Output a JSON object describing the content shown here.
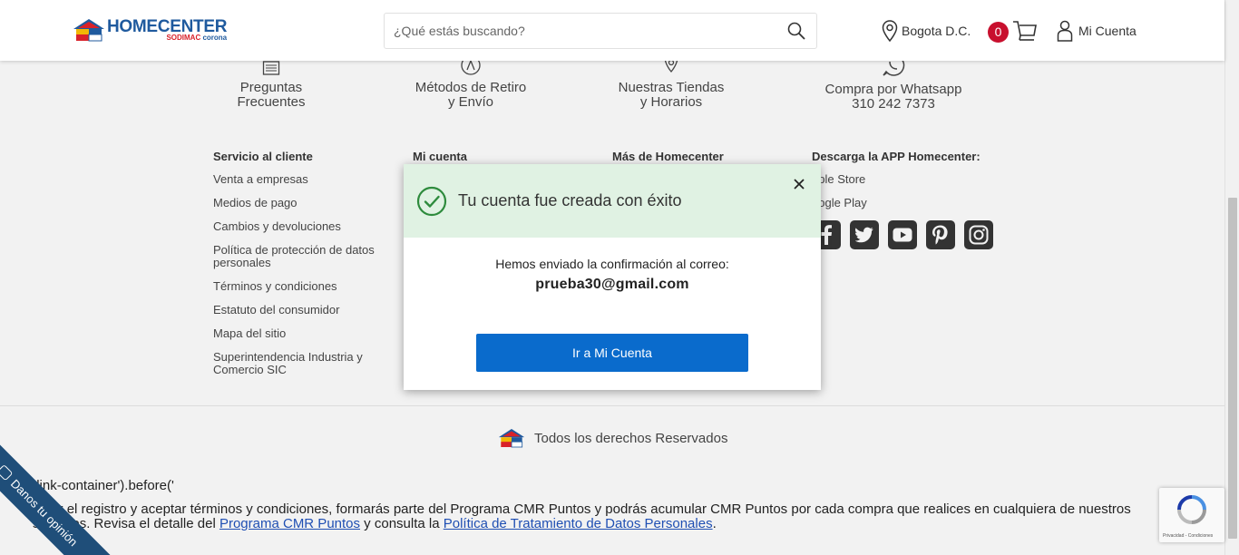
{
  "header": {
    "brand_name": "HOMECENTER",
    "brand_sub_a": "SODIMAC",
    "brand_sub_b": "corona",
    "search_placeholder": "¿Qué estás buscando?",
    "location": "Bogota D.C.",
    "cart_count": "0",
    "account_label": "Mi Cuenta"
  },
  "help_strip": [
    {
      "line1": "Preguntas",
      "line2": "Frecuentes",
      "icon": "list-icon"
    },
    {
      "line1": "Métodos de Retiro",
      "line2": "y Envío",
      "icon": "delivery-icon"
    },
    {
      "line1": "Nuestras Tiendas",
      "line2": "y Horarios",
      "icon": "store-pin-icon"
    },
    {
      "line1": "Compra por Whatsapp",
      "line2": "310 242 7373",
      "icon": "whatsapp-icon"
    }
  ],
  "footer": {
    "col1": {
      "title": "Servicio al cliente",
      "links": [
        "Venta a empresas",
        "Medios de pago",
        "Cambios y devoluciones",
        "Política de protección de datos personales",
        "Términos y condiciones",
        "Estatuto del consumidor",
        "Mapa del sitio",
        "Superintendencia Industria y Comercio SIC"
      ]
    },
    "col2": {
      "title": "Mi cuenta"
    },
    "col3": {
      "title": "Más de Homecenter"
    },
    "col4": {
      "title": "Descarga la APP Homecenter:",
      "links": [
        "pple Store",
        "oogle Play"
      ],
      "social": [
        "facebook-icon",
        "twitter-icon",
        "youtube-icon",
        "pinterest-icon",
        "instagram-icon"
      ]
    },
    "rights": "Todos los derechos Reservados"
  },
  "legal": {
    "line1": "div.link-container').before('",
    "line2": "pletar el registro y aceptar términos y condiciones, formarás parte del Programa CMR Puntos y podrás acumular CMR Puntos por cada compra que realices en cualquiera de nuestros",
    "line3a": "s aliados. Revisa el detalle del ",
    "line3_link1": "Programa CMR Puntos",
    "line3b": " y consulta la ",
    "line3_link2": "Política de Tratamiento de Datos Personales",
    "line3c": "."
  },
  "modal": {
    "title": "Tu cuenta fue creada con éxito",
    "message": "Hemos enviado la confirmación al correo:",
    "email": "prueba30@gmail.com",
    "button_label": "Ir a Mi Cuenta"
  },
  "feedback_tab": {
    "label_a": "Danos tu",
    "label_b": "opinión"
  },
  "recaptcha": {
    "text": "Privacidad - Condiciones"
  },
  "colors": {
    "brand_blue": "#1f5a9e",
    "brand_red": "#d9222a",
    "modal_header_bg": "#e0f2e3",
    "success_green": "#2e8b3d",
    "button_blue": "#0a6bcc",
    "badge_red": "#c8102e"
  }
}
